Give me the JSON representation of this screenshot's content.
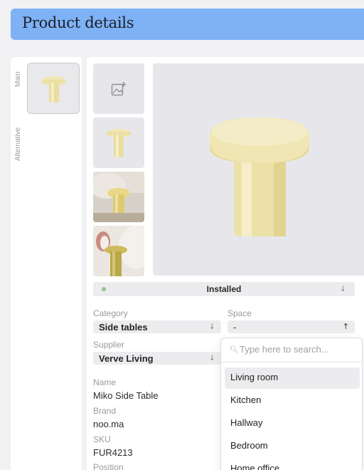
{
  "header": {
    "title": "Product details"
  },
  "image_tabs": {
    "main": "Main",
    "alternative": "Alternative"
  },
  "status": {
    "label": "Installed",
    "color": "#8cc69b"
  },
  "category": {
    "label": "Category",
    "value": "Side tables"
  },
  "space": {
    "label": "Space",
    "value": "-"
  },
  "supplier": {
    "label": "Supplier",
    "value": "Verve Living"
  },
  "name": {
    "label": "Name",
    "value": "Miko Side Table"
  },
  "brand": {
    "label": "Brand",
    "value": "noo.ma"
  },
  "sku": {
    "label": "SKU",
    "value": "FUR4213"
  },
  "position": {
    "label": "Position"
  },
  "space_dropdown": {
    "placeholder": "Type here to search...",
    "options": [
      "Living room",
      "Kitchen",
      "Hallway",
      "Bedroom",
      "Home office"
    ],
    "highlighted": "Living room"
  },
  "colors": {
    "header": "#7fb1f5",
    "product": "#efe6b3"
  }
}
